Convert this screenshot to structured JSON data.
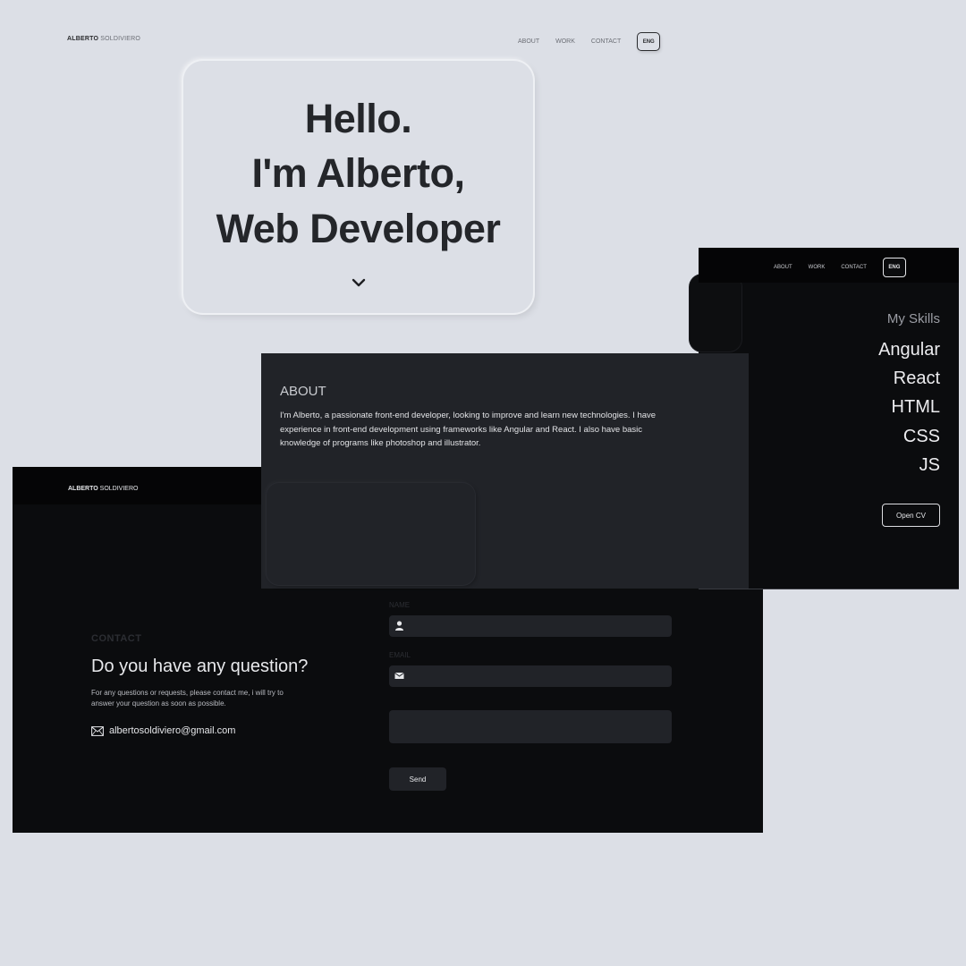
{
  "hero": {
    "brand_bold": "ALBERTO",
    "brand_thin": "SOLDIVIERO",
    "nav": [
      "ABOUT",
      "WORK",
      "CONTACT"
    ],
    "lang": "ENG",
    "line1": "Hello.",
    "line2": "I'm Alberto,",
    "line3": "Web Developer",
    "scroll_icon": "chevron-down-icon"
  },
  "skills_window": {
    "nav": [
      "ABOUT",
      "WORK",
      "CONTACT"
    ],
    "lang": "ENG",
    "title": "My Skills",
    "skills": [
      "Angular",
      "React",
      "HTML",
      "CSS",
      "JS"
    ],
    "cv_label": "Open CV"
  },
  "about_window": {
    "title": "ABOUT",
    "text": "I'm Alberto, a passionate front-end developer, looking to improve and learn new technologies. I have experience in front-end development using frameworks like Angular and React. I also have basic knowledge of programs like photoshop and illustrator."
  },
  "contact_window": {
    "brand_bold": "ALBERTO",
    "brand_thin": "SOLDIVIERO",
    "kicker": "CONTACT",
    "title": "Do you have any question?",
    "subtitle": "For any questions or requests, please contact me, i will try to answer your question as soon as possible.",
    "email": "albertosoldiviero@gmail.com",
    "name_label": "NAME",
    "email_label": "EMAIL",
    "send_label": "Send",
    "icons": [
      "mail-icon",
      "user-icon",
      "envelope-icon"
    ]
  },
  "colors": {
    "page_bg": "#dcdfe6",
    "dark_bg": "#0b0c0e",
    "panel_bg": "#212328",
    "text_light": "#e6e7ea"
  }
}
